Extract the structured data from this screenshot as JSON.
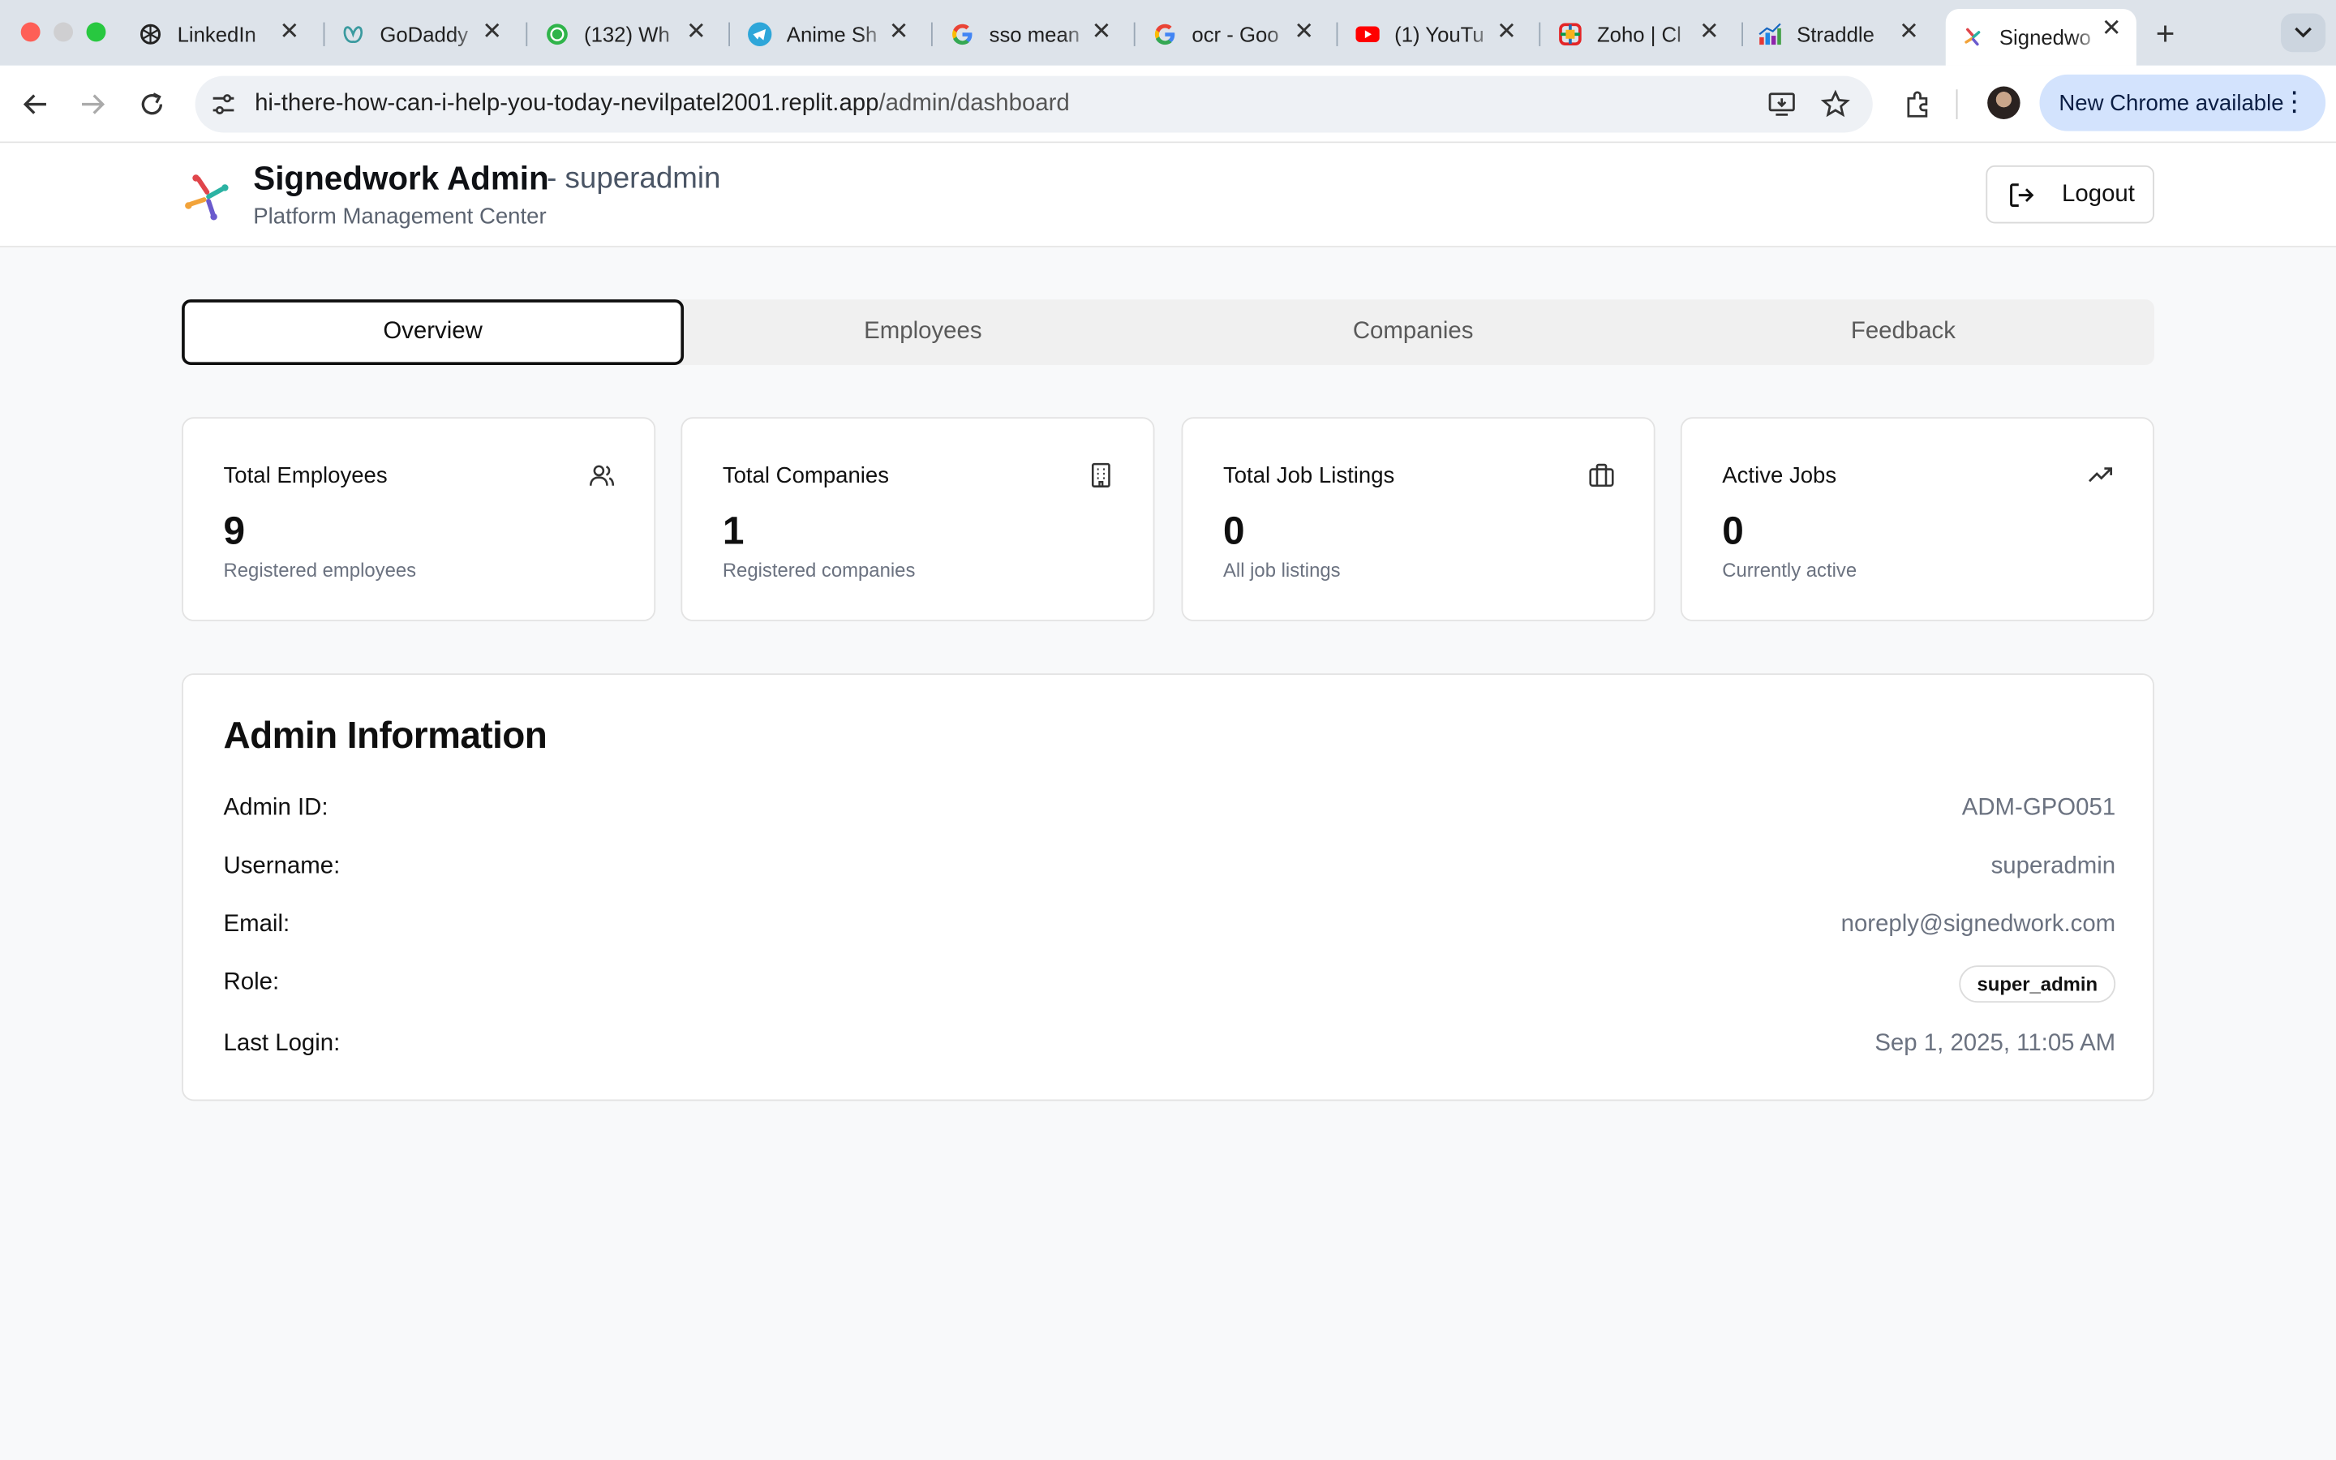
{
  "browser": {
    "tabs": [
      {
        "title": "LinkedIn",
        "icon": "openai-icon"
      },
      {
        "title": "GoDaddy",
        "icon": "godaddy-icon"
      },
      {
        "title": "(132) Wh",
        "icon": "whatsapp-icon"
      },
      {
        "title": "Anime Sh",
        "icon": "telegram-icon"
      },
      {
        "title": "sso mean",
        "icon": "google-icon"
      },
      {
        "title": "ocr - Goo",
        "icon": "google-icon"
      },
      {
        "title": "(1) YouTu",
        "icon": "youtube-icon"
      },
      {
        "title": "Zoho | Cl",
        "icon": "zoho-icon"
      },
      {
        "title": "Straddle",
        "icon": "chart-icon"
      },
      {
        "title": "Signedwo",
        "icon": "signedwork-icon"
      }
    ],
    "url_host": "hi-there-how-can-i-help-you-today-nevilpatel2001.replit.app",
    "url_path": "/admin/dashboard",
    "update_label": "New Chrome available"
  },
  "header": {
    "brand": "Signedwork Admin",
    "user": "- superadmin",
    "subtitle": "Platform Management Center",
    "logout_label": "Logout"
  },
  "tabs": [
    "Overview",
    "Employees",
    "Companies",
    "Feedback"
  ],
  "stats": [
    {
      "title": "Total Employees",
      "value": "9",
      "subtitle": "Registered employees",
      "icon": "users-icon"
    },
    {
      "title": "Total Companies",
      "value": "1",
      "subtitle": "Registered companies",
      "icon": "building-icon"
    },
    {
      "title": "Total Job Listings",
      "value": "0",
      "subtitle": "All job listings",
      "icon": "briefcase-icon"
    },
    {
      "title": "Active Jobs",
      "value": "0",
      "subtitle": "Currently active",
      "icon": "trending-up-icon"
    }
  ],
  "admin_info": {
    "title": "Admin Information",
    "rows": [
      {
        "label": "Admin ID:",
        "value": "ADM-GPO051"
      },
      {
        "label": "Username:",
        "value": "superadmin"
      },
      {
        "label": "Email:",
        "value": "noreply@signedwork.com"
      },
      {
        "label": "Role:",
        "value": "super_admin"
      },
      {
        "label": "Last Login:",
        "value": "Sep 1, 2025, 11:05 AM"
      }
    ]
  },
  "colors": {
    "accent_dark": "#0f0f0f",
    "muted_text": "#6b7280",
    "chrome_update_bg": "#d3e3fd",
    "page_bg": "#f8f9fa"
  }
}
